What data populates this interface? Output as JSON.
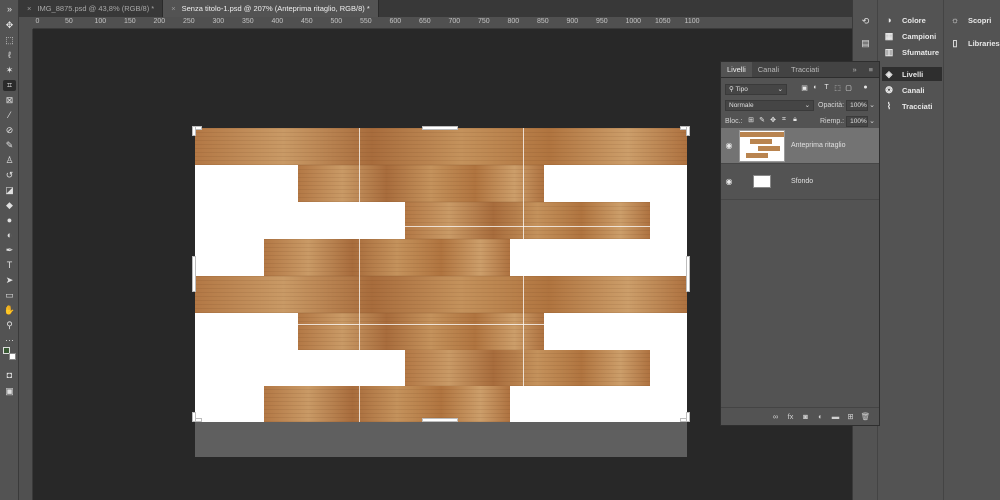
{
  "tabs": [
    {
      "label": "IMG_8875.psd @ 43,8% (RGB/8) *",
      "active": false
    },
    {
      "label": "Senza titolo-1.psd @ 207% (Anteprima ritaglio, RGB/8) *",
      "active": true
    }
  ],
  "ruler": {
    "marks": [
      "250",
      "200",
      "150",
      "100",
      "50",
      "0",
      "50",
      "100",
      "150",
      "200",
      "250",
      "300",
      "350",
      "400",
      "450",
      "500",
      "550",
      "600",
      "650",
      "700",
      "750",
      "800",
      "850",
      "900",
      "950",
      "1000",
      "1050",
      "1100"
    ]
  },
  "dock": {
    "col1": [
      {
        "label": "Colore",
        "icon": "color-wheel-icon"
      },
      {
        "label": "Campioni",
        "icon": "swatches-icon"
      },
      {
        "label": "Sfumature",
        "icon": "gradient-icon"
      },
      {
        "label": "Livelli",
        "icon": "layers-icon",
        "selected": true
      },
      {
        "label": "Canali",
        "icon": "channels-icon"
      },
      {
        "label": "Tracciati",
        "icon": "paths-icon"
      }
    ],
    "col2": [
      {
        "label": "Scopri",
        "icon": "lightbulb-icon"
      },
      {
        "label": "Libraries",
        "icon": "libraries-icon"
      }
    ]
  },
  "layers_panel": {
    "tabs": [
      "Livelli",
      "Canali",
      "Tracciati"
    ],
    "filter_kind": "Tipo",
    "blend_mode": "Normale",
    "opacity_label": "Opacità:",
    "opacity_value": "100%",
    "lock_label": "Bloc.:",
    "fill_label": "Riemp.:",
    "fill_value": "100%",
    "layers": [
      {
        "name": "Anteprima ritaglio",
        "visible": true,
        "selected": true
      },
      {
        "name": "Sfondo",
        "visible": true,
        "selected": false
      }
    ]
  }
}
